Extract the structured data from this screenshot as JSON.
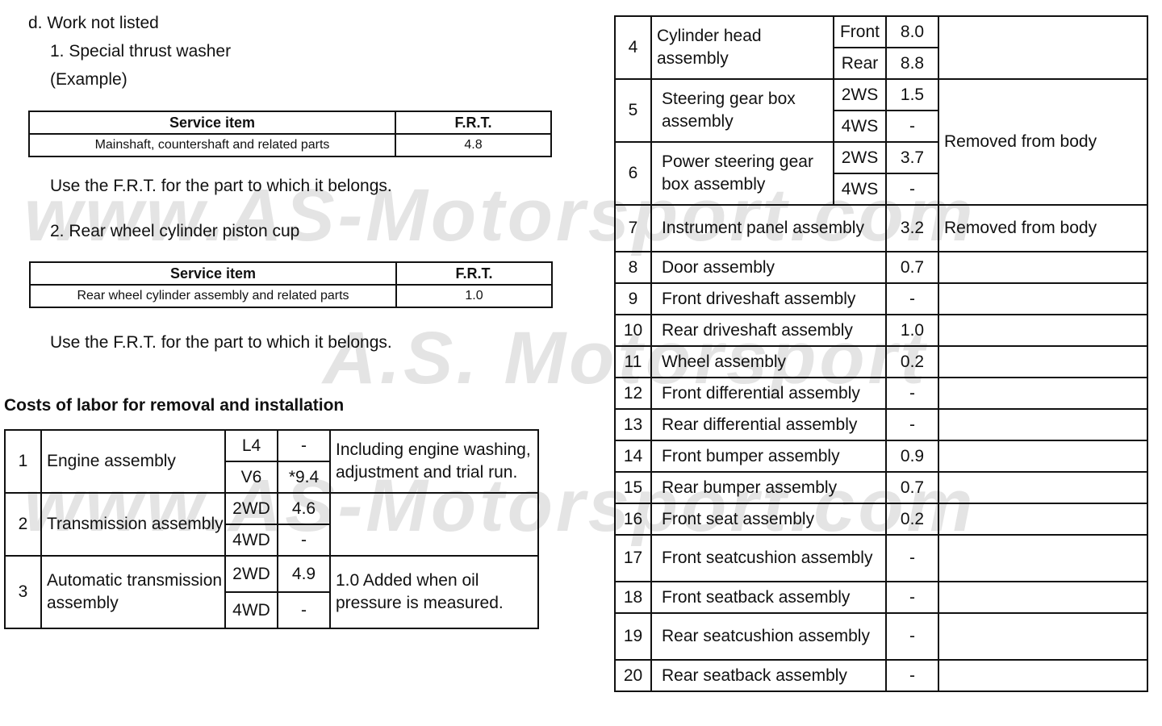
{
  "watermark": {
    "line1": "www.AS-Motorsport.com",
    "line2": "A.S. Motorsport",
    "line3": "www.AS-Motorsport.com"
  },
  "section": {
    "heading": "d. Work not listed",
    "item1": {
      "title": "1.  Special thrust washer",
      "example": "(Example)",
      "table": {
        "headers": [
          "Service item",
          "F.R.T."
        ],
        "rows": [
          [
            "Mainshaft, countershaft and related parts",
            "4.8"
          ]
        ]
      },
      "note": "Use the F.R.T. for the part to which it belongs."
    },
    "item2": {
      "title": "2.  Rear wheel cylinder piston cup",
      "table": {
        "headers": [
          "Service item",
          "F.R.T."
        ],
        "rows": [
          [
            "Rear wheel cylinder assembly and related parts",
            "1.0"
          ]
        ]
      },
      "note": "Use the F.R.T. for the part to which it belongs."
    }
  },
  "labor": {
    "heading": "Costs of labor for removal and installation",
    "rows": [
      {
        "no": "1",
        "item": "Engine assembly",
        "variants": [
          {
            "v": "L4",
            "frt": "-"
          },
          {
            "v": "V6",
            "frt": "*9.4"
          }
        ],
        "remark": "Including engine washing, adjustment and trial run."
      },
      {
        "no": "2",
        "item": "Transmission assembly",
        "variants": [
          {
            "v": "2WD",
            "frt": "4.6"
          },
          {
            "v": "4WD",
            "frt": "-"
          }
        ],
        "remark": ""
      },
      {
        "no": "3",
        "item": "Automatic transmission assembly",
        "variants": [
          {
            "v": "2WD",
            "frt": "4.9"
          },
          {
            "v": "4WD",
            "frt": "-"
          }
        ],
        "remark": "1.0 Added when oil pressure is measured."
      },
      {
        "no": "4",
        "item": "Cylinder head assembly",
        "variants": [
          {
            "v": "Front",
            "frt": "8.0"
          },
          {
            "v": "Rear",
            "frt": "8.8"
          }
        ],
        "remark": ""
      },
      {
        "no": "5",
        "item": "Steering gear box assembly",
        "variants": [
          {
            "v": "2WS",
            "frt": "1.5"
          },
          {
            "v": "4WS",
            "frt": "-"
          }
        ],
        "remark": "Removed from body"
      },
      {
        "no": "6",
        "item": "Power steering gear box assembly",
        "variants": [
          {
            "v": "2WS",
            "frt": "3.7"
          },
          {
            "v": "4WS",
            "frt": "-"
          }
        ],
        "remark": ""
      },
      {
        "no": "7",
        "item": "Instrument panel assembly",
        "frt": "3.2",
        "remark": "Removed from body"
      },
      {
        "no": "8",
        "item": "Door assembly",
        "frt": "0.7",
        "remark": ""
      },
      {
        "no": "9",
        "item": "Front driveshaft assembly",
        "frt": "-",
        "remark": ""
      },
      {
        "no": "10",
        "item": "Rear driveshaft assembly",
        "frt": "1.0",
        "remark": ""
      },
      {
        "no": "11",
        "item": "Wheel assembly",
        "frt": "0.2",
        "remark": ""
      },
      {
        "no": "12",
        "item": "Front differential assembly",
        "frt": "-",
        "remark": ""
      },
      {
        "no": "13",
        "item": "Rear differential assembly",
        "frt": "-",
        "remark": ""
      },
      {
        "no": "14",
        "item": "Front bumper assembly",
        "frt": "0.9",
        "remark": ""
      },
      {
        "no": "15",
        "item": "Rear bumper assembly",
        "frt": "0.7",
        "remark": ""
      },
      {
        "no": "16",
        "item": "Front seat assembly",
        "frt": "0.2",
        "remark": ""
      },
      {
        "no": "17",
        "item": "Front seatcushion assembly",
        "frt": "-",
        "remark": ""
      },
      {
        "no": "18",
        "item": "Front seatback assembly",
        "frt": "-",
        "remark": ""
      },
      {
        "no": "19",
        "item": "Rear seatcushion assembly",
        "frt": "-",
        "remark": ""
      },
      {
        "no": "20",
        "item": "Rear seatback assembly",
        "frt": "-",
        "remark": ""
      }
    ]
  }
}
